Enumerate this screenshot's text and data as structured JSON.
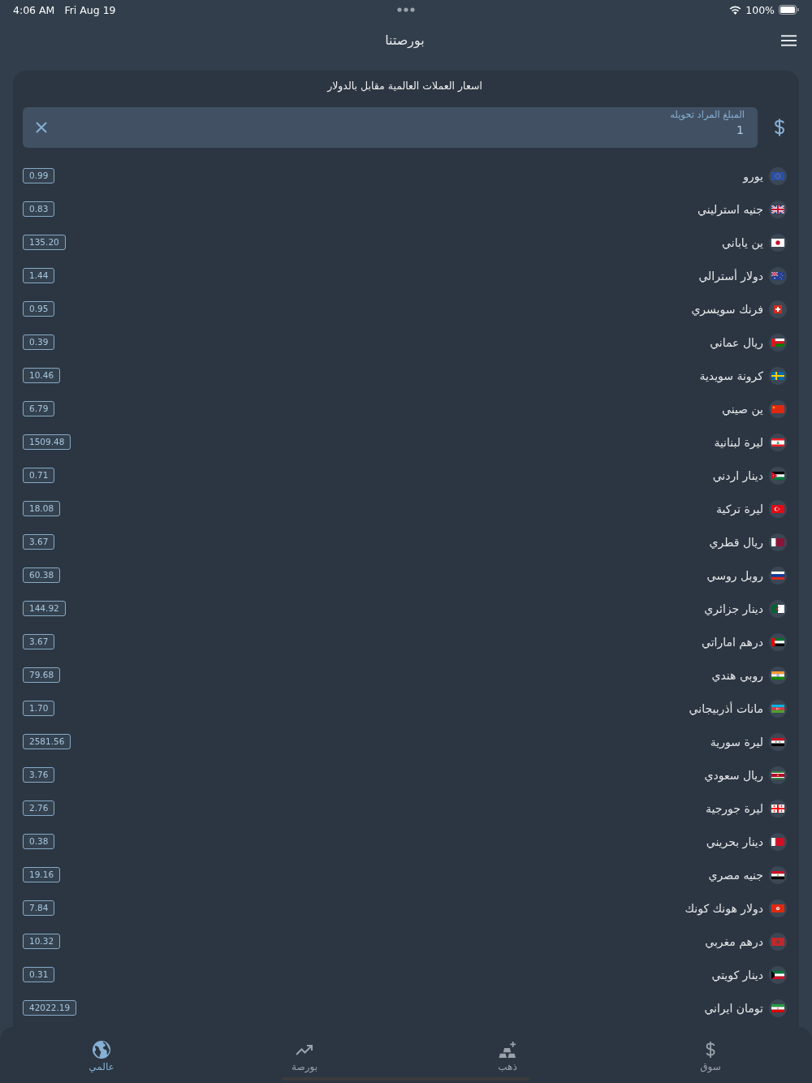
{
  "status_bar": {
    "time": "4:06 AM",
    "date": "Fri Aug 19",
    "battery": "100%"
  },
  "header": {
    "title": "بورصتنا"
  },
  "converter": {
    "title": "اسعار العملات العالمية مقابل بالدولار",
    "amount_field": {
      "label": "المبلغ المراد تحويله",
      "value": "1"
    }
  },
  "currencies": [
    {
      "kind": "eu",
      "name": "يورو",
      "rate": "0.99"
    },
    {
      "kind": "uk",
      "name": "جنيه استرليني",
      "rate": "0.83"
    },
    {
      "kind": "japan",
      "name": "ين ياباني",
      "rate": "135.20"
    },
    {
      "kind": "australia",
      "name": "دولار أسترالي",
      "rate": "1.44"
    },
    {
      "kind": "switzerland",
      "name": "فرنك سويسري",
      "rate": "0.95"
    },
    {
      "kind": "oman",
      "name": "ريال عماني",
      "rate": "0.39"
    },
    {
      "kind": "sweden",
      "name": "كرونة سويدية",
      "rate": "10.46"
    },
    {
      "kind": "china",
      "name": "ين صيني",
      "rate": "6.79"
    },
    {
      "kind": "lebanon",
      "name": "ليرة لبنانية",
      "rate": "1509.48"
    },
    {
      "kind": "jordan",
      "name": "دينار اردني",
      "rate": "0.71"
    },
    {
      "kind": "turkey",
      "name": "ليرة تركية",
      "rate": "18.08"
    },
    {
      "kind": "qatar",
      "name": "ريال قطري",
      "rate": "3.67"
    },
    {
      "kind": "russia",
      "name": "روبل روسي",
      "rate": "60.38"
    },
    {
      "kind": "algeria",
      "name": "دينار جزائري",
      "rate": "144.92"
    },
    {
      "kind": "uae",
      "name": "درهم اماراتي",
      "rate": "3.67"
    },
    {
      "kind": "india",
      "name": "روبي هندي",
      "rate": "79.68"
    },
    {
      "kind": "azerbaijan",
      "name": "مانات أذربيجاني",
      "rate": "1.70"
    },
    {
      "kind": "syria",
      "name": "ليرة سورية",
      "rate": "2581.56"
    },
    {
      "kind": "suriname",
      "name": "ريال سعودي",
      "rate": "3.76"
    },
    {
      "kind": "georgia",
      "name": "ليرة جورجية",
      "rate": "2.76"
    },
    {
      "kind": "bahrain",
      "name": "دينار بحريني",
      "rate": "0.38"
    },
    {
      "kind": "egypt",
      "name": "جنيه مصري",
      "rate": "19.16"
    },
    {
      "kind": "hongkong",
      "name": "دولار هونك كونك",
      "rate": "7.84"
    },
    {
      "kind": "morocco",
      "name": "درهم مغربي",
      "rate": "10.32"
    },
    {
      "kind": "kuwait",
      "name": "دينار كويتي",
      "rate": "0.31"
    },
    {
      "kind": "iran",
      "name": "تومان ايراني",
      "rate": "42022.19"
    }
  ],
  "tab_bar": {
    "tabs": [
      {
        "kind": "dollar",
        "label": "سوق",
        "selected": false
      },
      {
        "kind": "ingots",
        "label": "ذهب",
        "selected": false
      },
      {
        "kind": "trend",
        "label": "بورصة",
        "selected": false
      },
      {
        "kind": "globe",
        "label": "عالمي",
        "selected": true
      }
    ]
  }
}
